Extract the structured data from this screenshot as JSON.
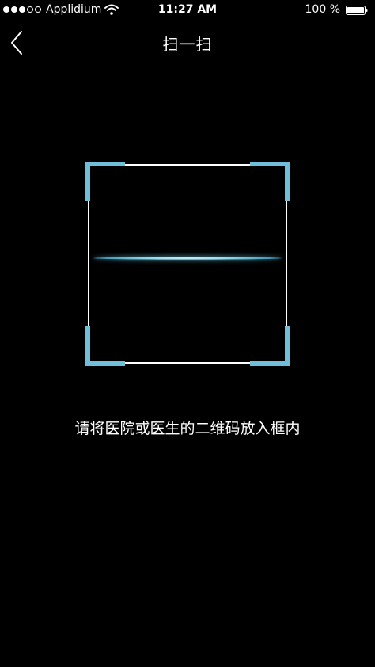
{
  "status_bar": {
    "signal_bars_filled": 3,
    "signal_bars_total": 5,
    "carrier": "Applidium",
    "wifi_icon": "wifi-icon",
    "time": "11:27 AM",
    "battery_text": "100 %",
    "battery_level": 1.0,
    "battery_icon": "battery-icon"
  },
  "nav": {
    "back_icon": "chevron-left-icon",
    "title": "扫一扫"
  },
  "scanner": {
    "accent_color": "#6fbfda",
    "frame_color": "#ffffff",
    "hint": "请将医院或医生的二维码放入框内"
  },
  "colors": {
    "background": "#000000",
    "text": "#ffffff"
  }
}
